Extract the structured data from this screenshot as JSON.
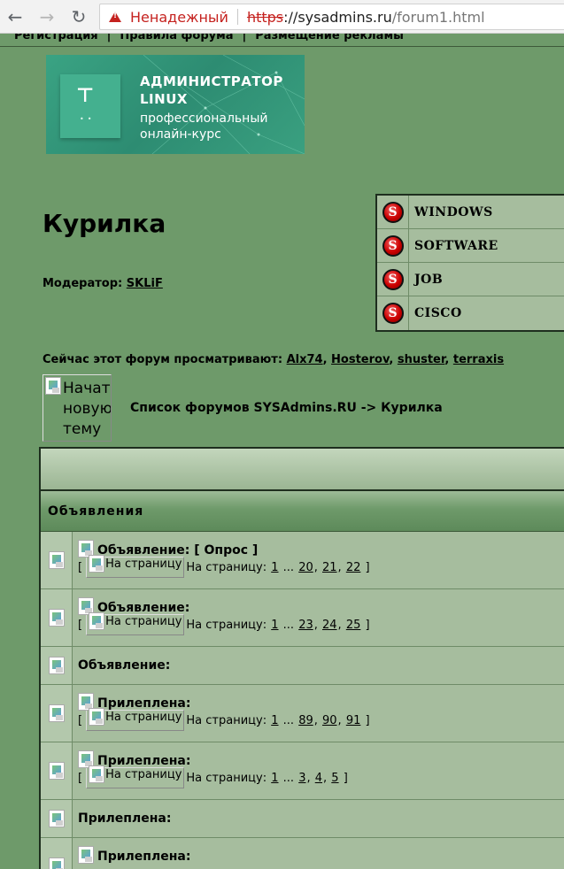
{
  "browser": {
    "security_label": "Ненадежный",
    "url_scheme": "https",
    "url_host": "://sysadmins.ru",
    "url_path": "/forum1.html"
  },
  "topnav": {
    "items": [
      "Регистрация",
      "Правила форума",
      "Размещение рекламы"
    ]
  },
  "banner": {
    "title_line1": "АДМИНИСТРАТОР",
    "title_line2": "LINUX",
    "sub_line1": "профессиональный",
    "sub_line2": "онлайн-курс"
  },
  "page": {
    "title": "Курилка",
    "moderator_label": "Модератор:",
    "moderator_name": "SKLiF"
  },
  "categories": [
    {
      "label": "WINDOWS"
    },
    {
      "label": "SOFTWARE"
    },
    {
      "label": "JOB"
    },
    {
      "label": "CISCO"
    }
  ],
  "viewers": {
    "label": "Сейчас этот форум просматривают:",
    "users": [
      "Alx74",
      "Hosterov",
      "shuster",
      "terraxis"
    ]
  },
  "new_topic_alt": [
    "Начать",
    "новую",
    "тему"
  ],
  "breadcrumb": "Список форумов SYSAdmins.RU -> Курилка",
  "forum": {
    "section_title": "Объявления",
    "pager_alt": "На страницу",
    "pager_label": "На страницу:",
    "topics": [
      {
        "title": "Объявление: [ Опрос ]",
        "pages": [
          "1",
          "...",
          "20",
          "21",
          "22"
        ]
      },
      {
        "title": "Объявление:",
        "pages": [
          "1",
          "...",
          "23",
          "24",
          "25"
        ]
      },
      {
        "title": "Объявление:",
        "pages": []
      },
      {
        "title": "Прилеплена:",
        "pages": [
          "1",
          "...",
          "89",
          "90",
          "91"
        ]
      },
      {
        "title": "Прилеплена:",
        "pages": [
          "1",
          "...",
          "3",
          "4",
          "5"
        ]
      },
      {
        "title": "Прилеплена:",
        "pages": []
      },
      {
        "title": "Прилеплена:",
        "pages": []
      }
    ]
  }
}
